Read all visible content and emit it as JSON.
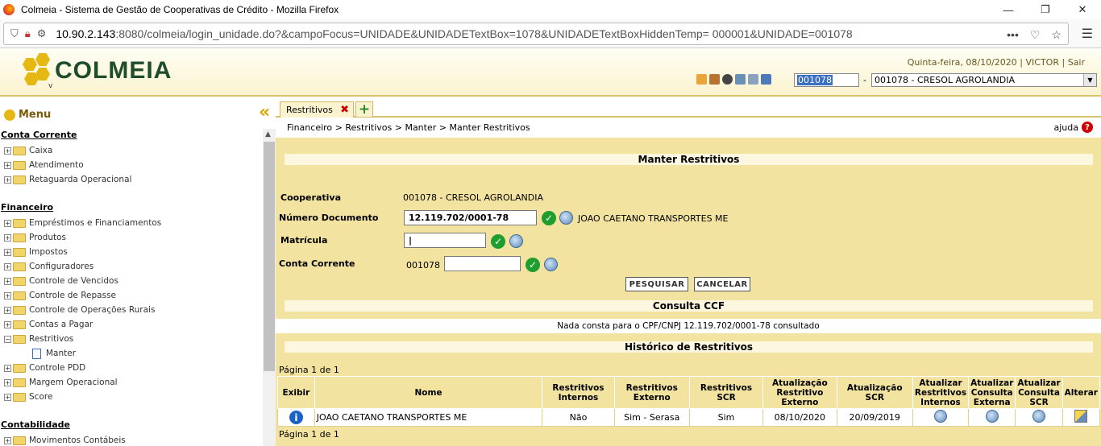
{
  "window": {
    "title": "Colmeia - Sistema de Gestão de Cooperativas de Crédito - Mozilla Firefox"
  },
  "browser": {
    "url_host": "10.90.2.143",
    "url_rest": ":8080/colmeia/login_unidade.do?&campoFocus=UNIDADE&UNIDADETextBox=1078&UNIDADETextBoxHiddenTemp= 000001&UNIDADE=001078"
  },
  "header": {
    "logo_text": "COLMEIA",
    "logo_sub": "v",
    "date": "Quinta-feira, 08/10/2020",
    "user": "VICTOR",
    "logout": "Sair",
    "unit_code": "001078",
    "unit_select": "001078 - CRESOL AGROLANDIA"
  },
  "menu": {
    "title": "Menu",
    "conta_corrente": "Conta Corrente",
    "cc_items": [
      "Caixa",
      "Atendimento",
      "Retaguarda Operacional"
    ],
    "financeiro": "Financeiro",
    "fin_items": [
      "Empréstimos e Financiamentos",
      "Produtos",
      "Impostos",
      "Configuradores",
      "Controle de Vencidos",
      "Controle de Repasse",
      "Controle de Operações Rurais",
      "Contas a Pagar",
      "Restritivos"
    ],
    "fin_leaf": "Manter",
    "fin_items2": [
      "Controle PDD",
      "Margem Operacional",
      "Score"
    ],
    "contabilidade": "Contabilidade",
    "cont_items": [
      "Movimentos Contábeis"
    ]
  },
  "tab": {
    "label": "Restritivos"
  },
  "breadcrumb": "Financeiro > Restritivos > Manter > Manter Restritivos",
  "help": "ajuda",
  "form": {
    "title": "Manter Restritivos",
    "cooperativa_label": "Cooperativa",
    "cooperativa_value": "001078 - CRESOL AGROLANDIA",
    "doc_label": "Número Documento",
    "doc_value": "12.119.702/0001-78",
    "doc_name": "JOAO CAETANO TRANSPORTES ME",
    "matricula_label": "Matrícula",
    "conta_label": "Conta Corrente",
    "conta_prefix": "001078",
    "search_btn": "PESQUISAR",
    "cancel_btn": "CANCELAR"
  },
  "ccf": {
    "title": "Consulta CCF",
    "message": "Nada consta para o CPF/CNPJ 12.119.702/0001-78 consultado"
  },
  "history": {
    "title": "Histórico de Restritivos",
    "page_top": "Página 1 de 1",
    "page_bottom": "Página 1 de 1",
    "columns": [
      "Exibir",
      "Nome",
      "Restritivos Internos",
      "Restritivos Externo",
      "Restritivos SCR",
      "Atualização Restritivo Externo",
      "Atualização SCR",
      "Atualizar Restritivos Internos",
      "Atualizar Consulta Externa",
      "Atualizar Consulta SCR",
      "Alterar"
    ],
    "rows": [
      {
        "nome": "JOAO CAETANO TRANSPORTES ME",
        "internos": "Não",
        "externo": "Sim - Serasa",
        "scr": "Sim",
        "atu_externo": "08/10/2020",
        "atu_scr": "20/09/2019"
      }
    ]
  }
}
